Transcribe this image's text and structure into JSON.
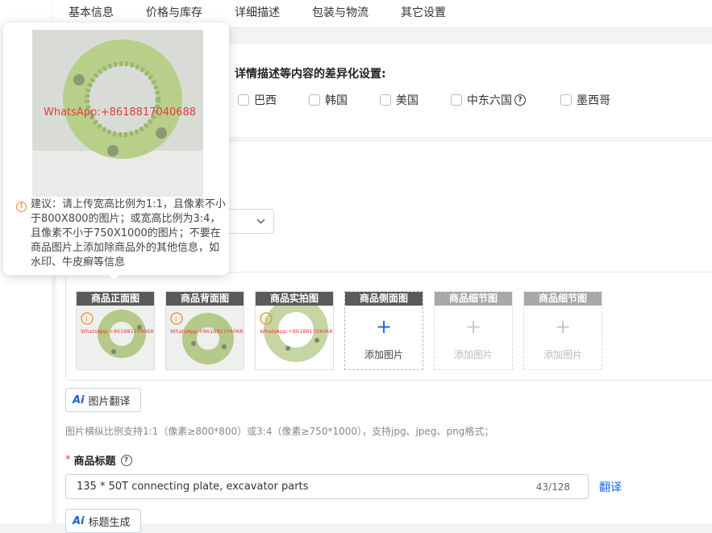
{
  "tabs": [
    "基本信息",
    "价格与库存",
    "详细描述",
    "包装与物流",
    "其它设置"
  ],
  "diff": {
    "label": "详情描述等内容的差异化设置:",
    "options": [
      "巴西",
      "韩国",
      "美国",
      "中东六国",
      "墨西哥"
    ]
  },
  "tooltip": {
    "watermark": "WhatsApp:+8618817040688",
    "text": "建议：请上传宽高比例为1:1，且像素不小于800X800的图片；或宽高比例为3:4，且像素不小于750X1000的图片；不要在商品图片上添加除商品外的其他信息，如水印、牛皮癣等信息"
  },
  "images": {
    "slots": [
      {
        "label": "商品正面图",
        "filled": true
      },
      {
        "label": "商品背面图",
        "filled": true
      },
      {
        "label": "商品实拍图",
        "filled": true
      },
      {
        "label": "商品侧面图",
        "filled": false,
        "add": "添加图片"
      },
      {
        "label": "商品细节图",
        "filled": false,
        "add": "添加图片"
      },
      {
        "label": "商品细节图",
        "filled": false,
        "add": "添加图片"
      }
    ],
    "thumb_watermark": "WhatsApp:+8618817040688",
    "translate_button": "图片翻译",
    "hint": "图片横纵比例支持1:1（像素≥800*800）或3:4（像素≥750*1000），支持jpg、jpeg、png格式；"
  },
  "title": {
    "required_mark": "*",
    "label": "商品标题",
    "value": "135 * 50T connecting plate, excavator parts",
    "count": "43/128",
    "translate": "翻译",
    "generate_button": "标题生成"
  },
  "colors": {
    "accent": "#1a66ff",
    "warning": "#e8902a",
    "required": "#e5412d"
  }
}
